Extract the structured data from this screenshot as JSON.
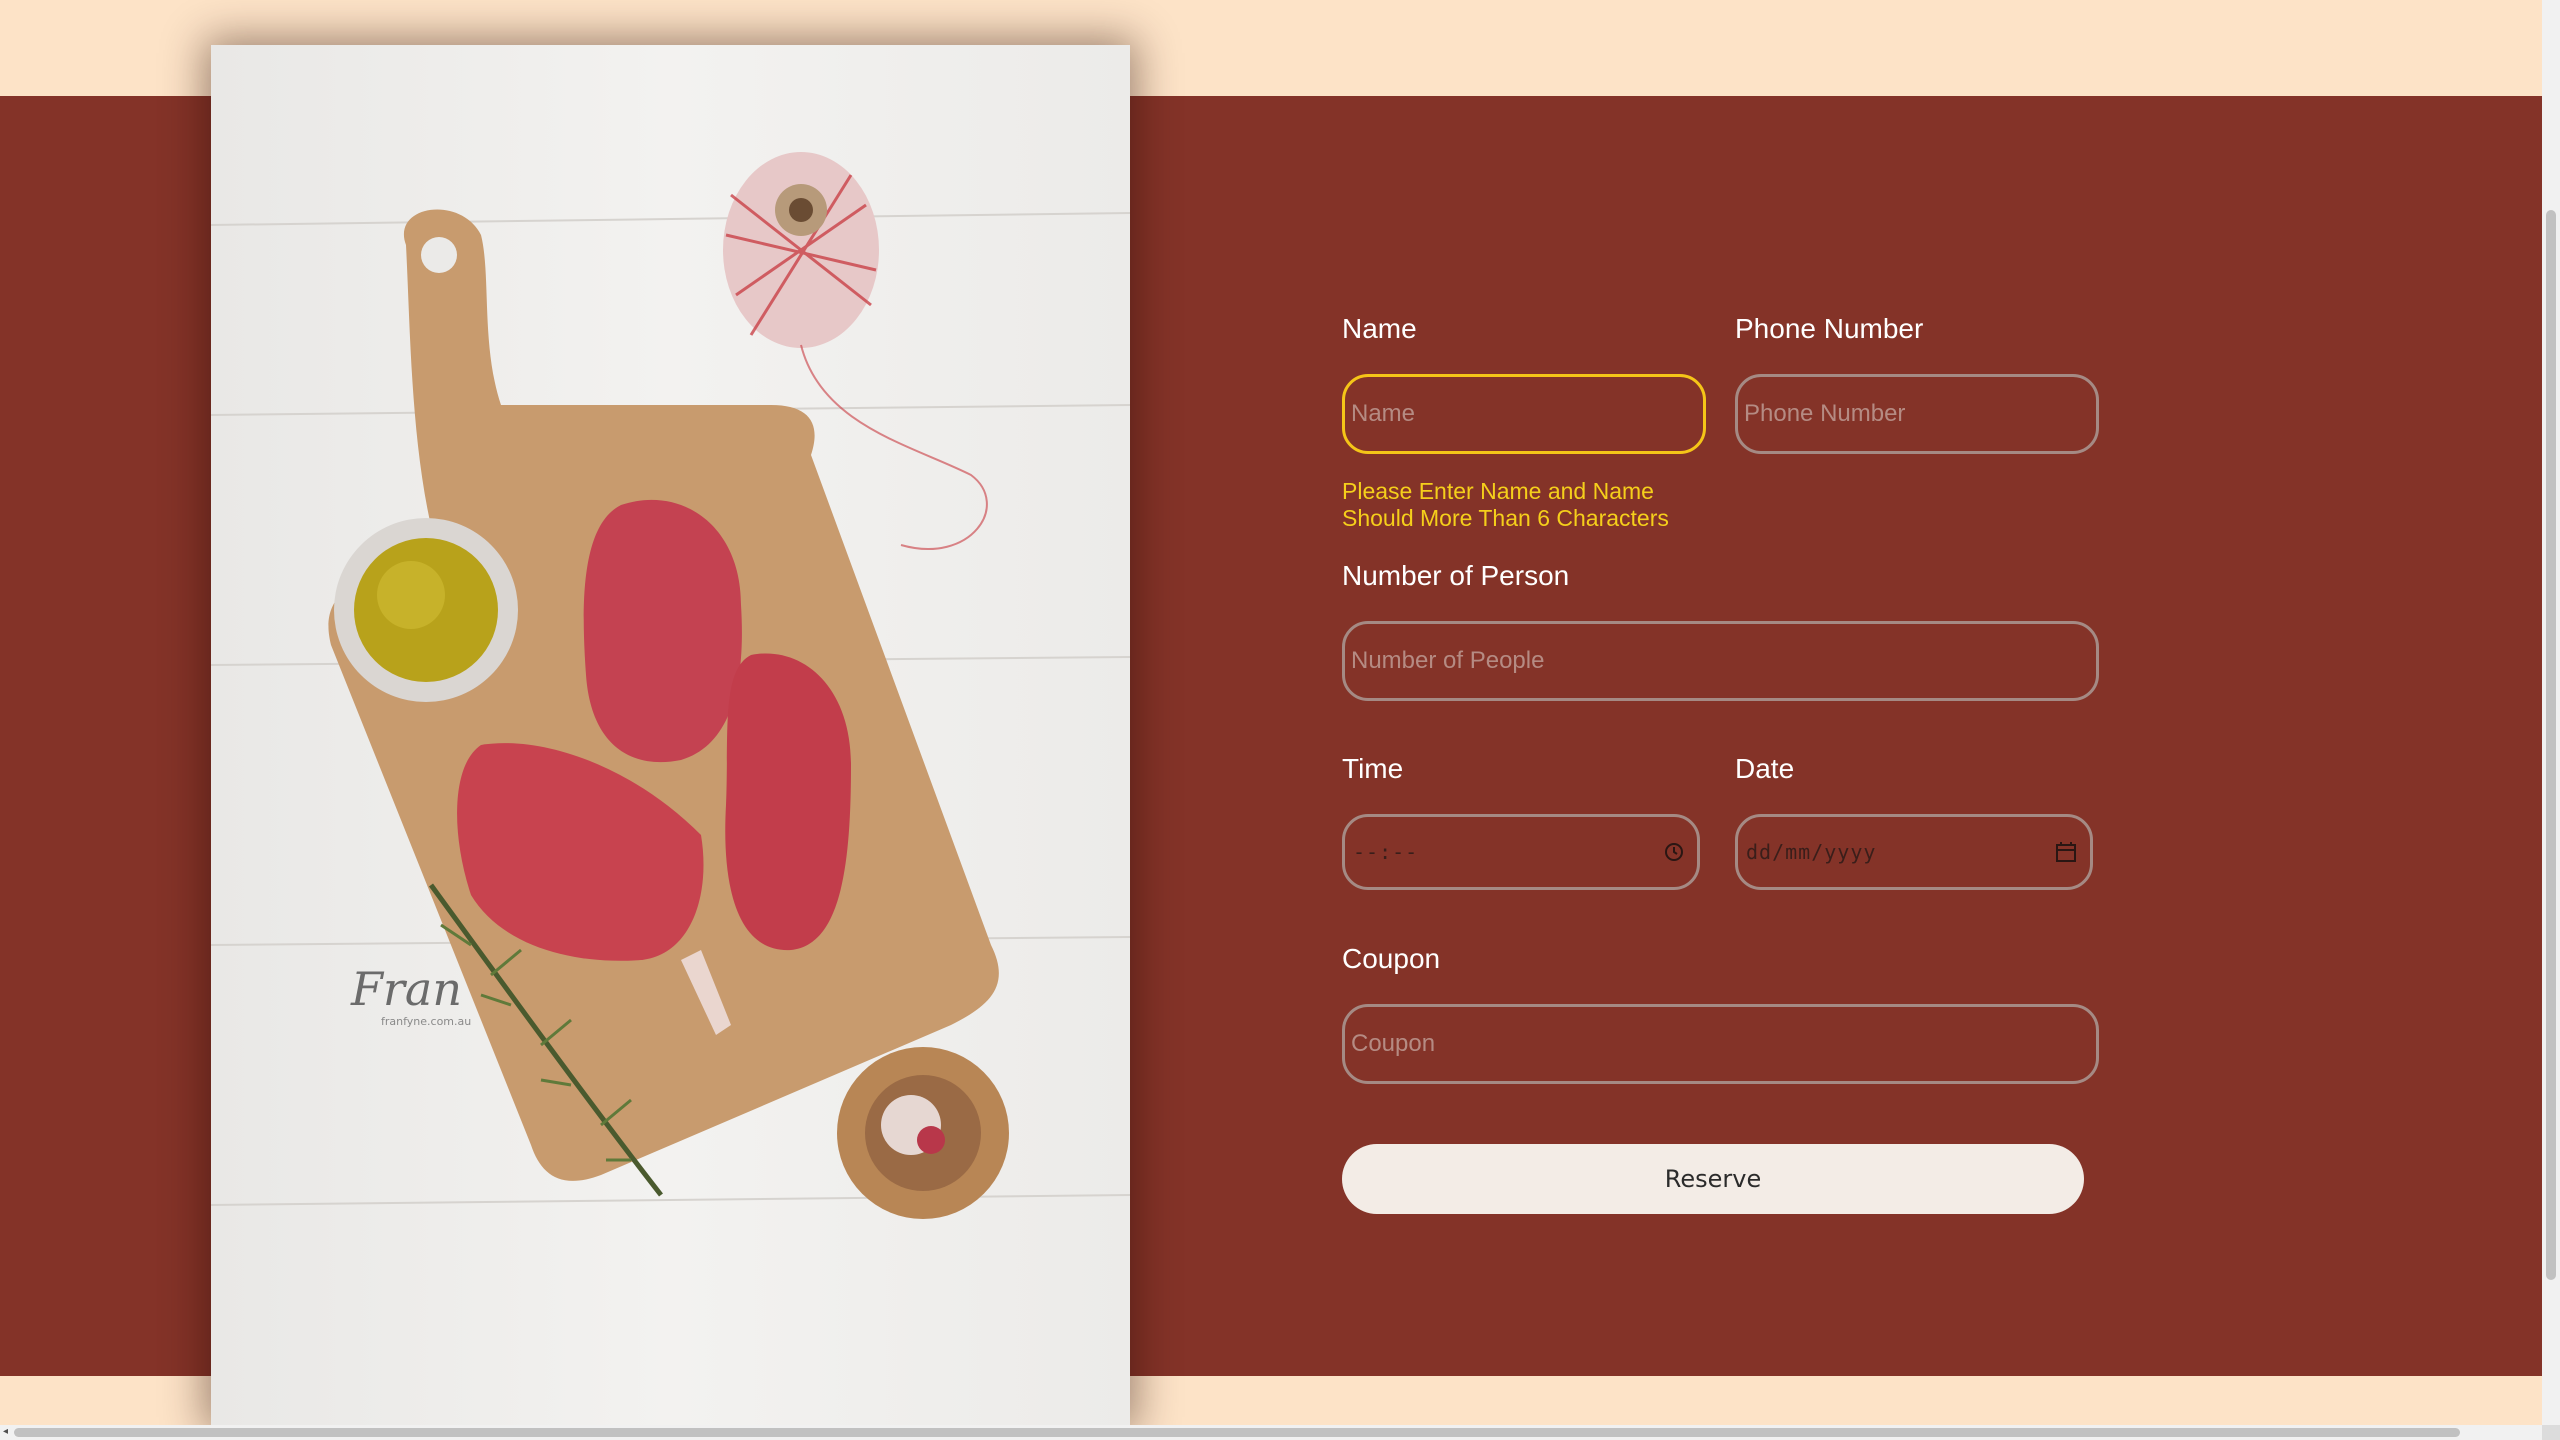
{
  "form": {
    "name": {
      "label": "Name",
      "placeholder": "Name",
      "error": "Please Enter Name and Name Should More Than 6 Characters"
    },
    "phone": {
      "label": "Phone Number",
      "placeholder": "Phone Number"
    },
    "people": {
      "label": "Number of Person",
      "placeholder": "Number of People"
    },
    "time": {
      "label": "Time",
      "placeholder": "--:--",
      "icon": "clock-icon"
    },
    "date": {
      "label": "Date",
      "placeholder": "dd/mm/yyyy",
      "icon": "calendar-icon"
    },
    "coupon": {
      "label": "Coupon",
      "placeholder": "Coupon"
    },
    "reserve_label": "Reserve"
  },
  "photo": {
    "description_icon": "steak-board-photo",
    "watermark": "Fran",
    "watermark_url": "franfyne.com.au"
  },
  "colors": {
    "page_background": "#fde3c7",
    "band_background": "#843328",
    "focus_border": "#f5c518",
    "error_text": "#f5cf1b",
    "field_border": "#a58a84",
    "button_background": "#f3ece6"
  }
}
